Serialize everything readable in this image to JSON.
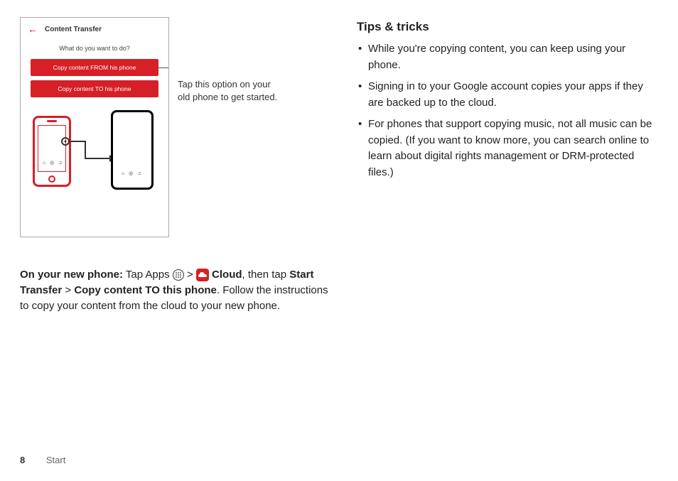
{
  "mock": {
    "back_icon": "←",
    "title": "Content Transfer",
    "question": "What do you want to do?",
    "btn_from": "Copy content FROM   his phone",
    "btn_to": "Copy content TO   his phone"
  },
  "callout": {
    "line1": "Tap this option on your",
    "line2": "old phone to get started."
  },
  "illustration": {
    "icons_glyphs": "⌂ ◎ ♫"
  },
  "body": {
    "prefix_bold": "On your new phone:",
    "text1": " Tap Apps ",
    "gt1": " > ",
    "cloud_label": " Cloud",
    "text2": ", then tap ",
    "start_transfer": "Start Transfer",
    "gt2": " > ",
    "copy_to": "Copy content TO this phone",
    "text3": ". Follow the instructions to copy your content from the cloud to your new phone."
  },
  "tips": {
    "title": "Tips & tricks",
    "items": [
      "While you're copying content, you can keep using your phone.",
      "Signing in to your Google account copies your apps if they are backed up to the cloud.",
      "For phones that support copying music, not all music can be copied. (If you want to know more, you can search online to learn about digital rights management or DRM-protected files.)"
    ]
  },
  "footer": {
    "page_number": "8",
    "section": "Start"
  }
}
